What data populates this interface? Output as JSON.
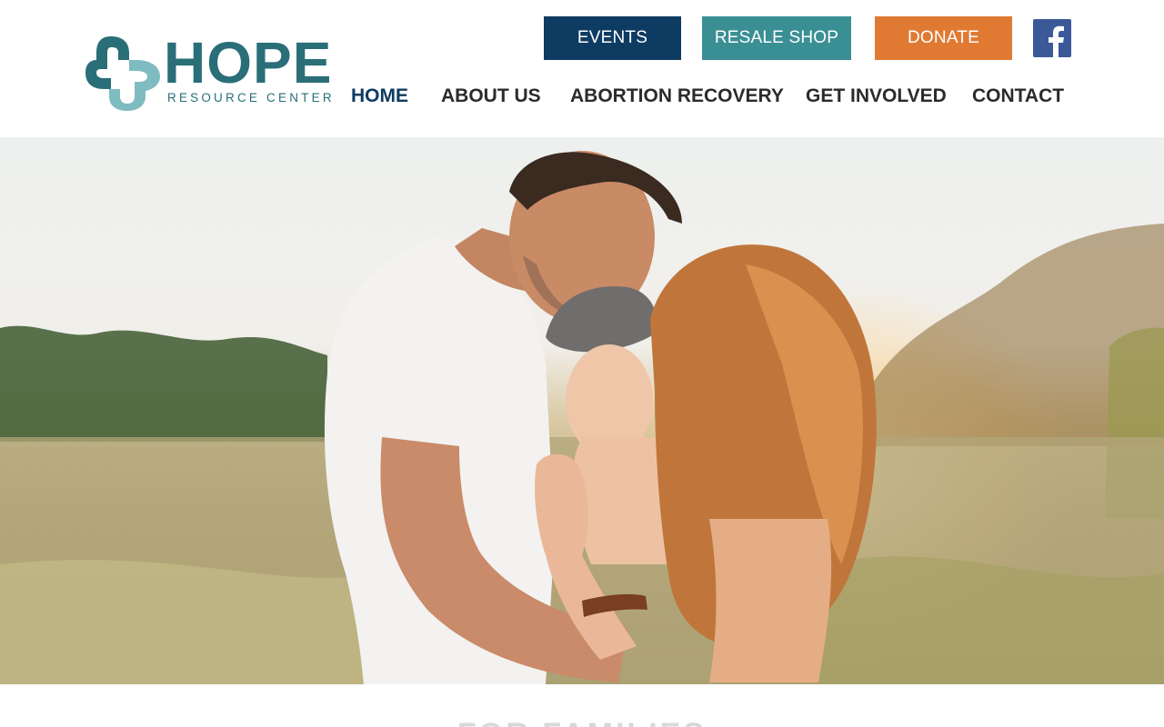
{
  "logo": {
    "word": "HOPE",
    "subtitle": "RESOURCE CENTER"
  },
  "top_buttons": {
    "events": "EVENTS",
    "resale": "RESALE SHOP",
    "donate": "DONATE"
  },
  "social": {
    "facebook_icon": "facebook-icon"
  },
  "nav": {
    "items": [
      {
        "label": "HOME",
        "active": true
      },
      {
        "label": "ABOUT US",
        "active": false
      },
      {
        "label": "ABORTION RECOVERY",
        "active": false
      },
      {
        "label": "GET INVOLVED",
        "active": false
      },
      {
        "label": "CONTACT",
        "active": false
      }
    ]
  },
  "hero": {
    "image": "family photo in sunlit field"
  },
  "section": {
    "partial_title": "FOR FAMILIES"
  },
  "colors": {
    "brand_teal": "#2a6e78",
    "navy": "#0e3b62",
    "teal_button": "#3a8f94",
    "orange_button": "#e07a33",
    "facebook_blue": "#3b5998"
  }
}
